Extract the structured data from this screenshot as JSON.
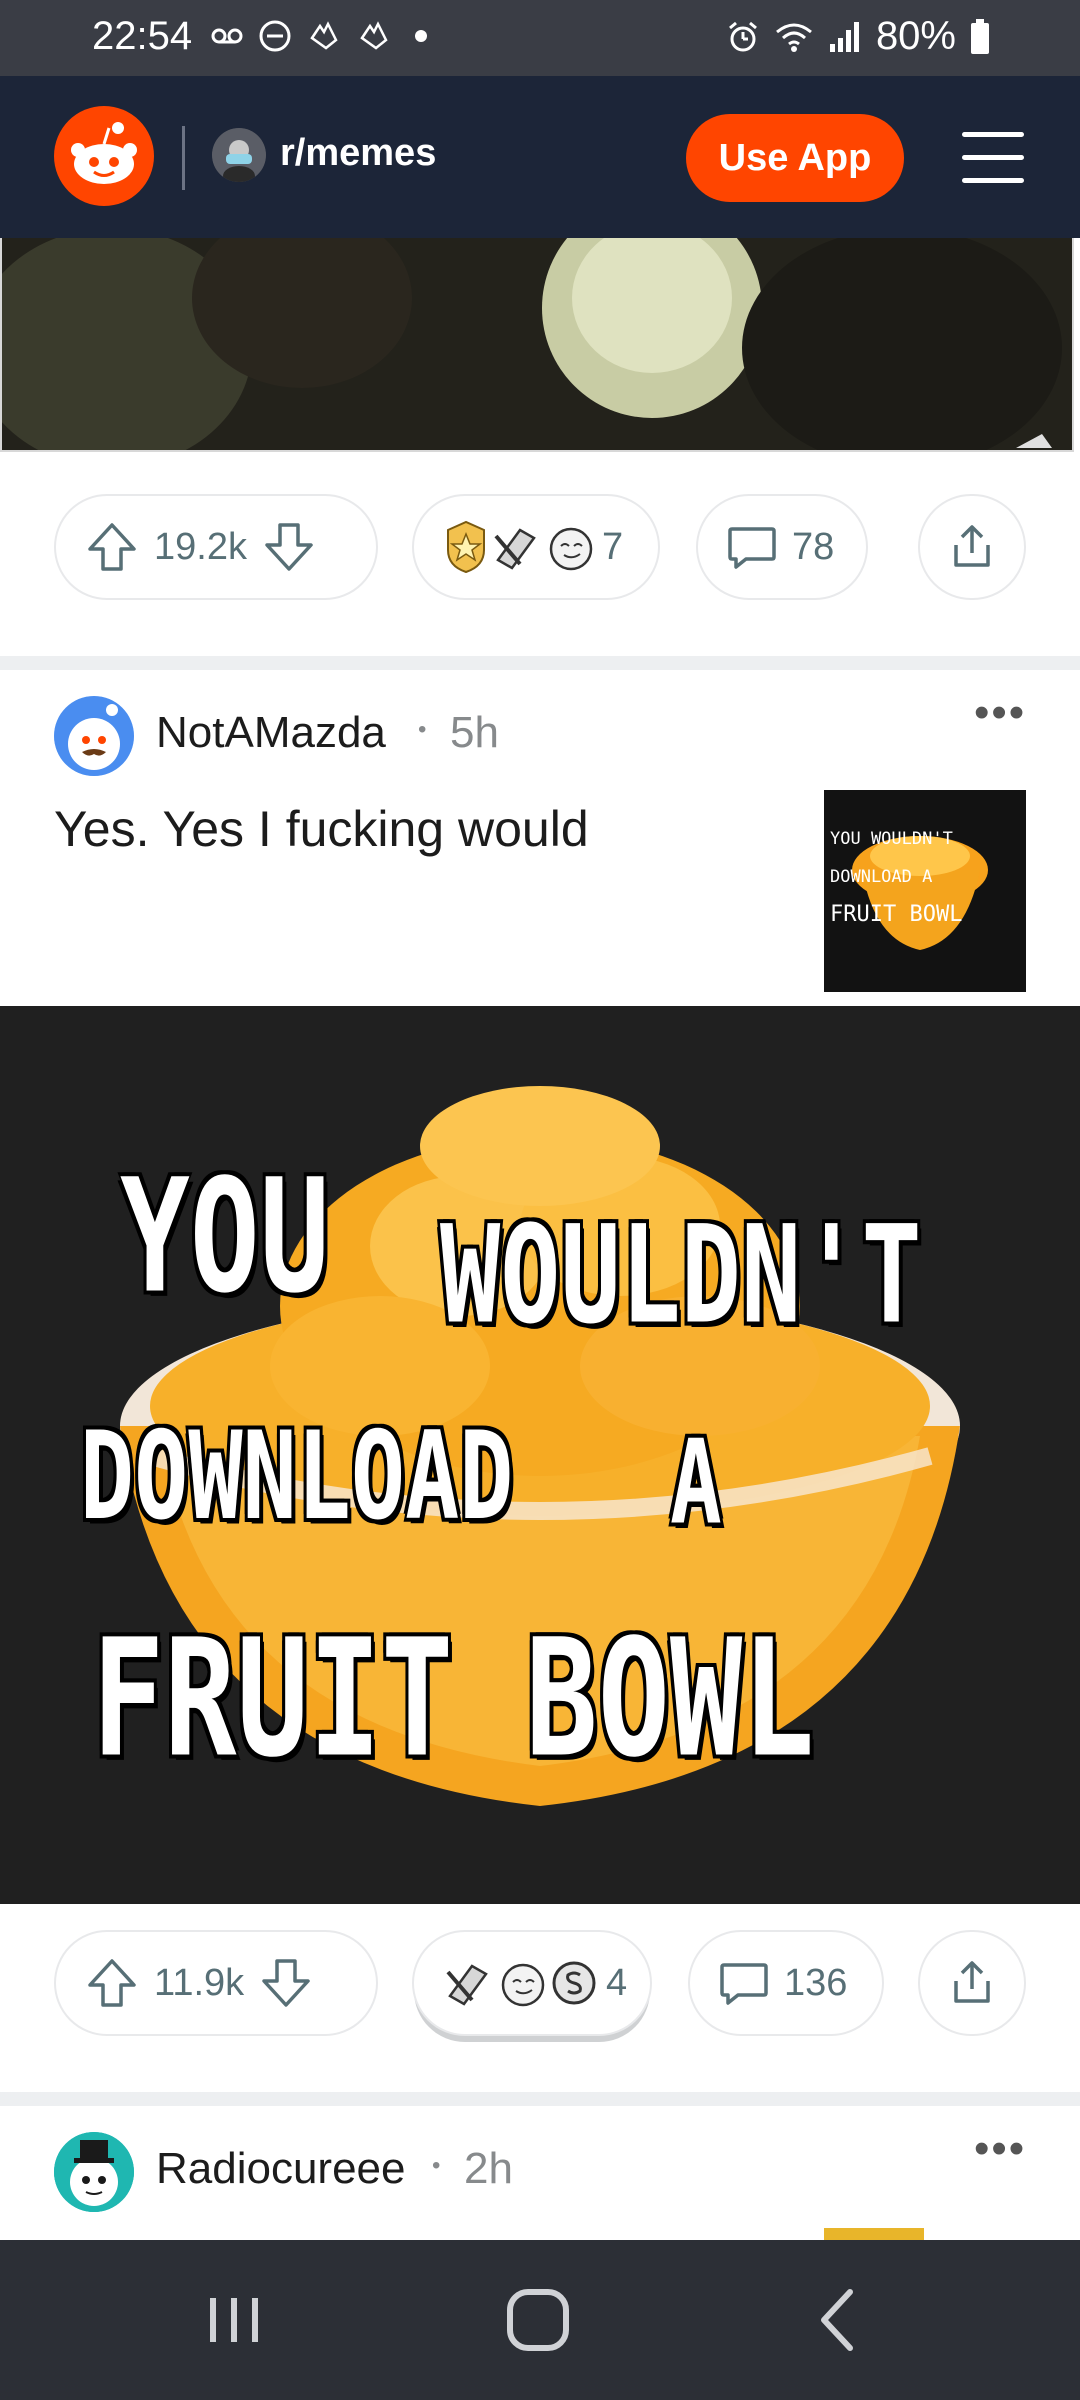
{
  "status_bar": {
    "time": "22:54",
    "battery": "80%",
    "icons": [
      "voicemail-icon",
      "dnd-icon",
      "gesture-icon",
      "gesture-icon",
      "dot-icon",
      "alarm-icon",
      "wifi-icon",
      "signal-icon",
      "battery-icon"
    ]
  },
  "header": {
    "subreddit": "r/memes",
    "use_app_label": "Use App",
    "logo_icon": "reddit-logo-icon",
    "menu_icon": "hamburger-menu-icon"
  },
  "post1": {
    "upvotes": "19.2k",
    "awards_count": "7",
    "comments": "78"
  },
  "post2": {
    "author": "NotAMazda",
    "time": "5h",
    "title": "Yes. Yes I fucking would",
    "thumb_text": {
      "line1": "YOU WOULDN'T",
      "line2": "DOWNLOAD A",
      "line3": "FRUIT BOWL"
    },
    "image_text": {
      "you": "YOU",
      "wouldnt": "WOULDN'T",
      "download": "DOWNLOAD",
      "a": "A",
      "fruit_bowl": "FRUIT BOWL"
    },
    "upvotes": "11.9k",
    "awards_count": "4",
    "comments": "136"
  },
  "post3": {
    "author": "Radiocureee",
    "time": "2h"
  },
  "more_label": "•••",
  "colors": {
    "accent": "#ff4500",
    "header_bg": "#1c2538",
    "status_bg": "#3a3d45",
    "muted": "#878a8c"
  }
}
